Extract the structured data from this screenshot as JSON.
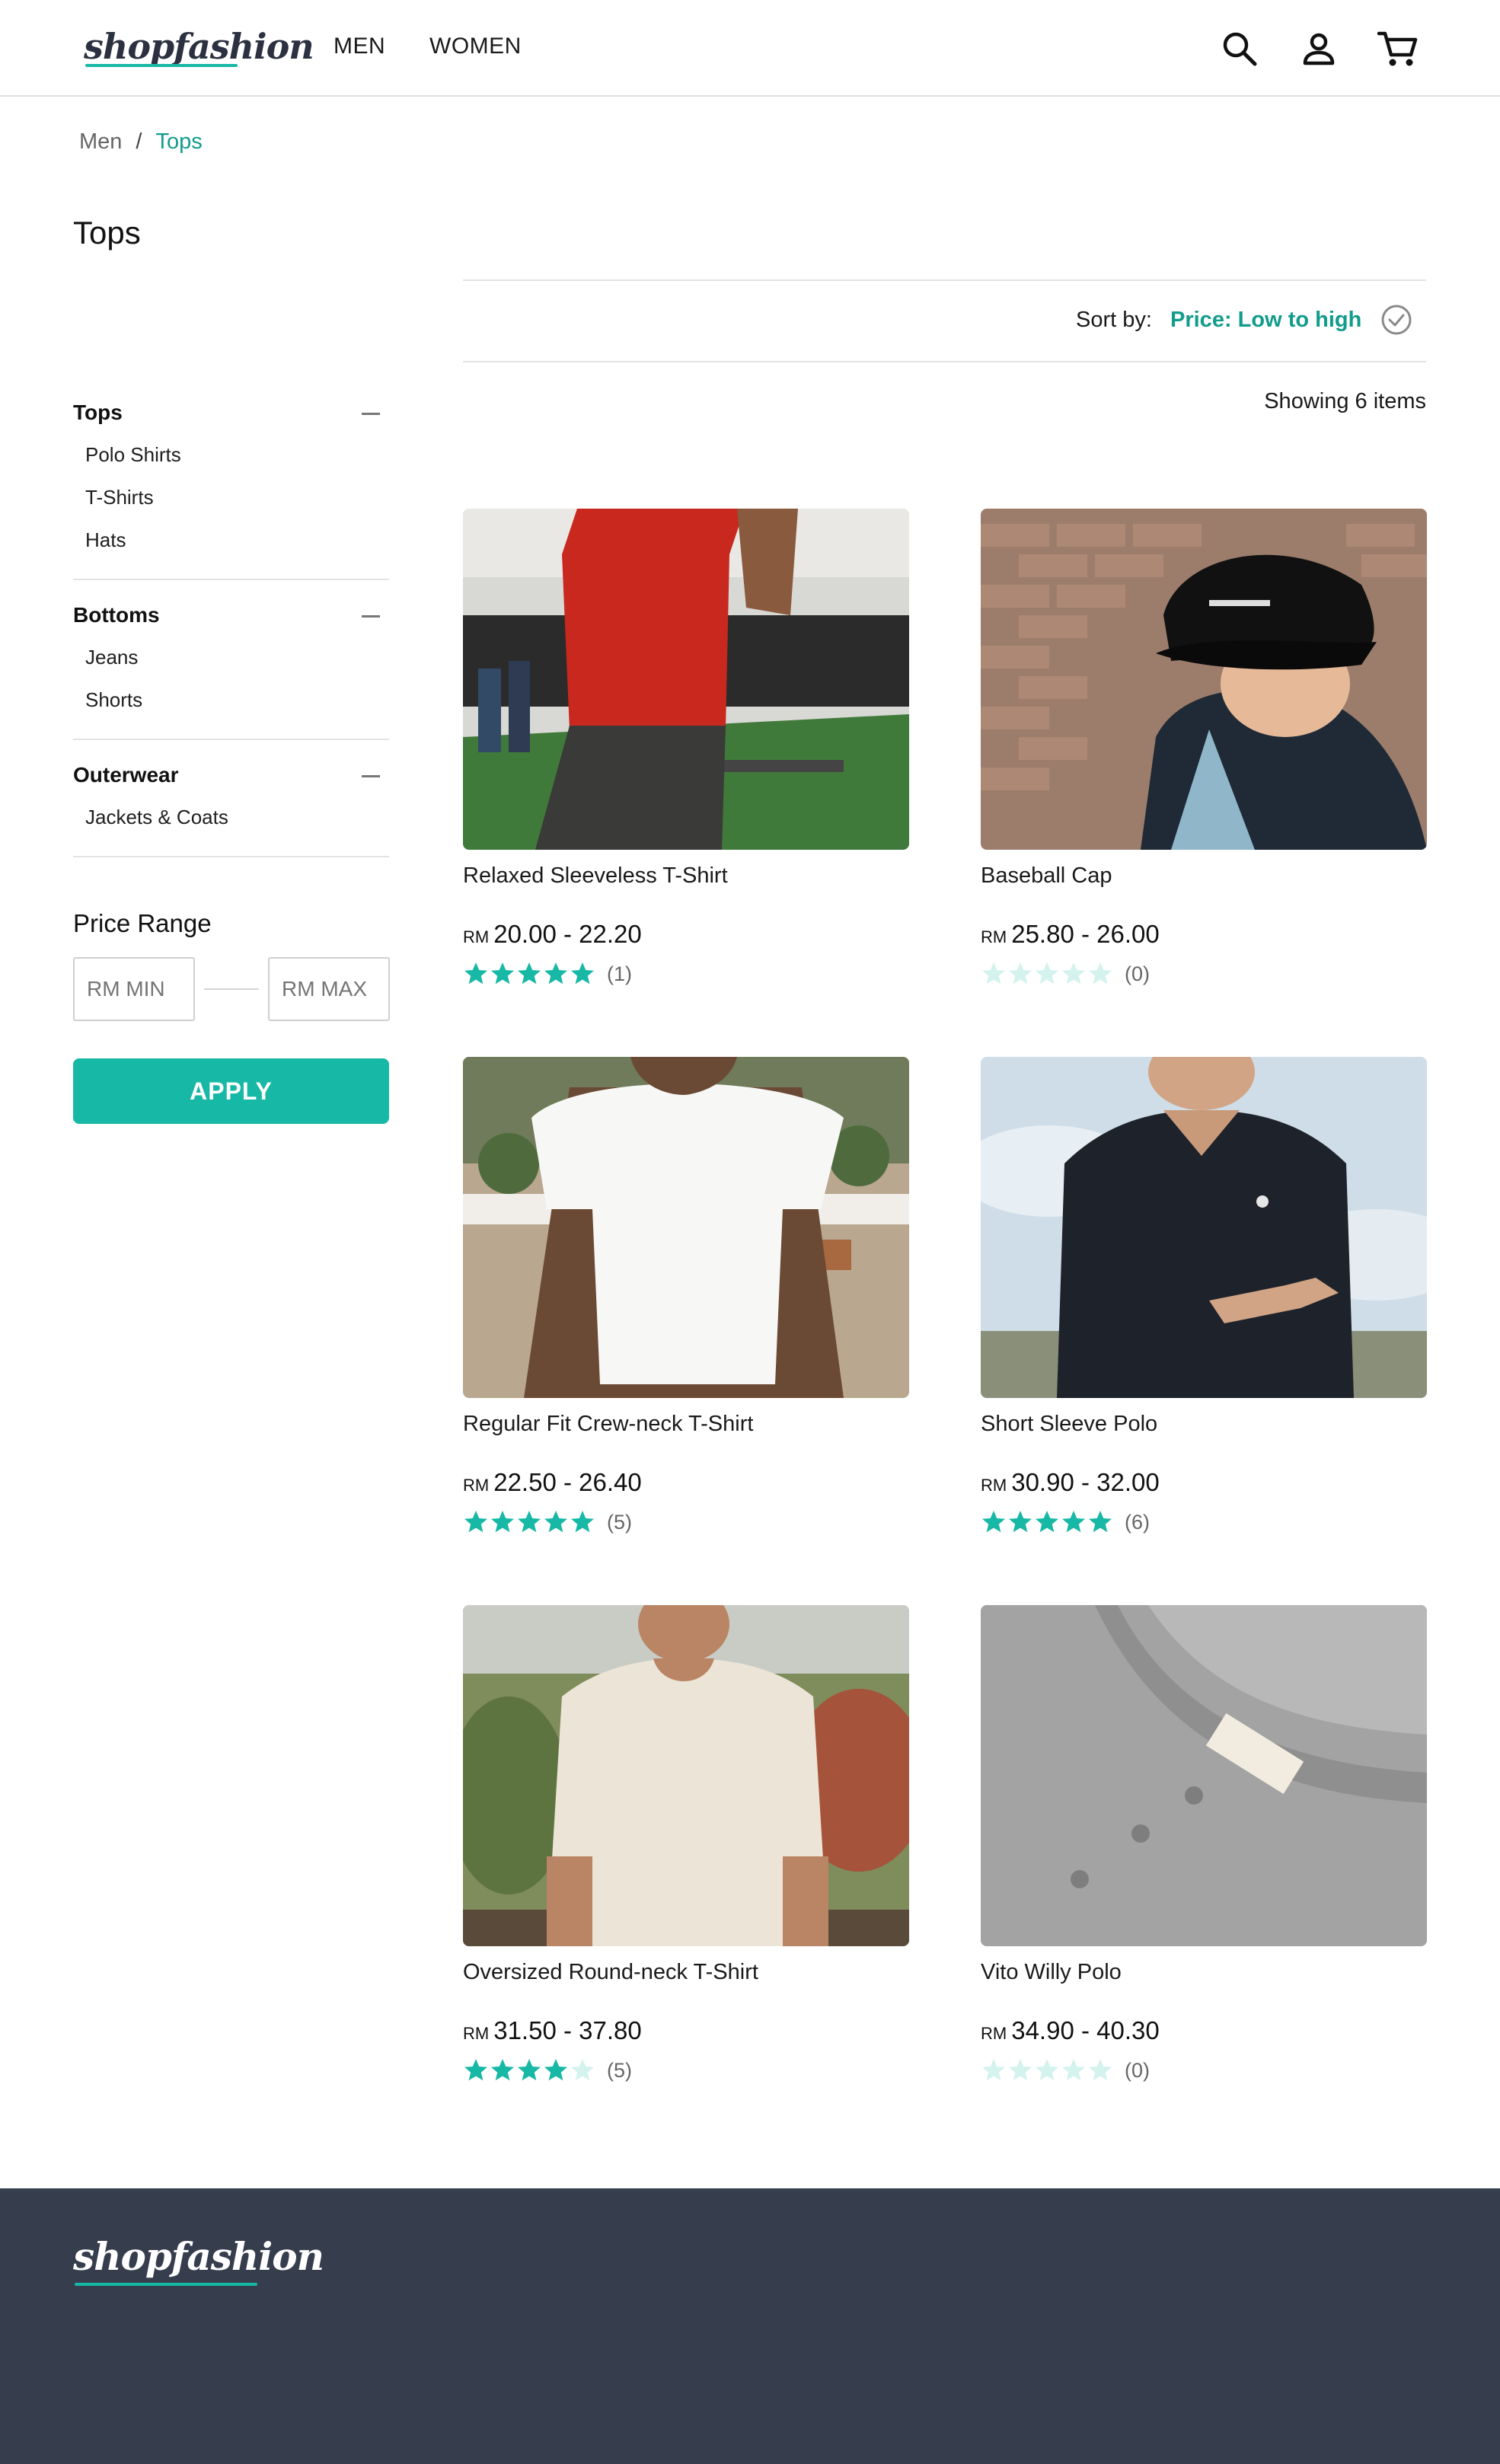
{
  "brand": {
    "logo": "shopfashion",
    "accent_color": "#17b8a6",
    "footer_color": "#363d4d"
  },
  "nav": {
    "men": "MEN",
    "women": "WOMEN"
  },
  "header_icons": [
    "search-icon",
    "user-icon",
    "cart-icon"
  ],
  "breadcrumb": {
    "parent": "Men",
    "separator": "/",
    "current": "Tops"
  },
  "page": {
    "title": "Tops"
  },
  "filters": {
    "categories": [
      {
        "label": "Tops",
        "items": [
          "Polo Shirts",
          "T-Shirts",
          "Hats"
        ]
      },
      {
        "label": "Bottoms",
        "items": [
          "Jeans",
          "Shorts"
        ]
      },
      {
        "label": "Outerwear",
        "items": [
          "Jackets & Coats"
        ]
      }
    ],
    "price_range": {
      "title": "Price Range",
      "min_placeholder": "RM MIN",
      "max_placeholder": "RM MAX",
      "apply_label": "APPLY"
    }
  },
  "sort": {
    "label": "Sort by:",
    "value": "Price: Low to high"
  },
  "results": {
    "showing": "Showing 6 items"
  },
  "products": [
    {
      "name": "Relaxed Sleeveless T-Shirt",
      "currency": "RM",
      "price": "20.00 - 22.20",
      "rating": 5,
      "reviews": "(1)",
      "image": "man in red sleeveless shirt at gym"
    },
    {
      "name": "Baseball Cap",
      "currency": "RM",
      "price": "25.80 - 26.00",
      "rating": 0,
      "reviews": "(0)",
      "image": "man wearing black baseball cap"
    },
    {
      "name": "Regular Fit Crew-neck T-Shirt",
      "currency": "RM",
      "price": "22.50 - 26.40",
      "rating": 5,
      "reviews": "(5)",
      "image": "man in white t-shirt"
    },
    {
      "name": "Short Sleeve Polo",
      "currency": "RM",
      "price": "30.90 - 32.00",
      "rating": 5,
      "reviews": "(6)",
      "image": "man in black polo shirt"
    },
    {
      "name": "Oversized Round-neck T-Shirt",
      "currency": "RM",
      "price": "31.50 - 37.80",
      "rating": 4,
      "reviews": "(5)",
      "image": "man in cream oversized t-shirt"
    },
    {
      "name": "Vito Willy Polo",
      "currency": "RM",
      "price": "34.90 - 40.30",
      "rating": 0,
      "reviews": "(0)",
      "image": "grey polo shirt collar"
    }
  ],
  "footer": {
    "logo": "shopfashion"
  }
}
